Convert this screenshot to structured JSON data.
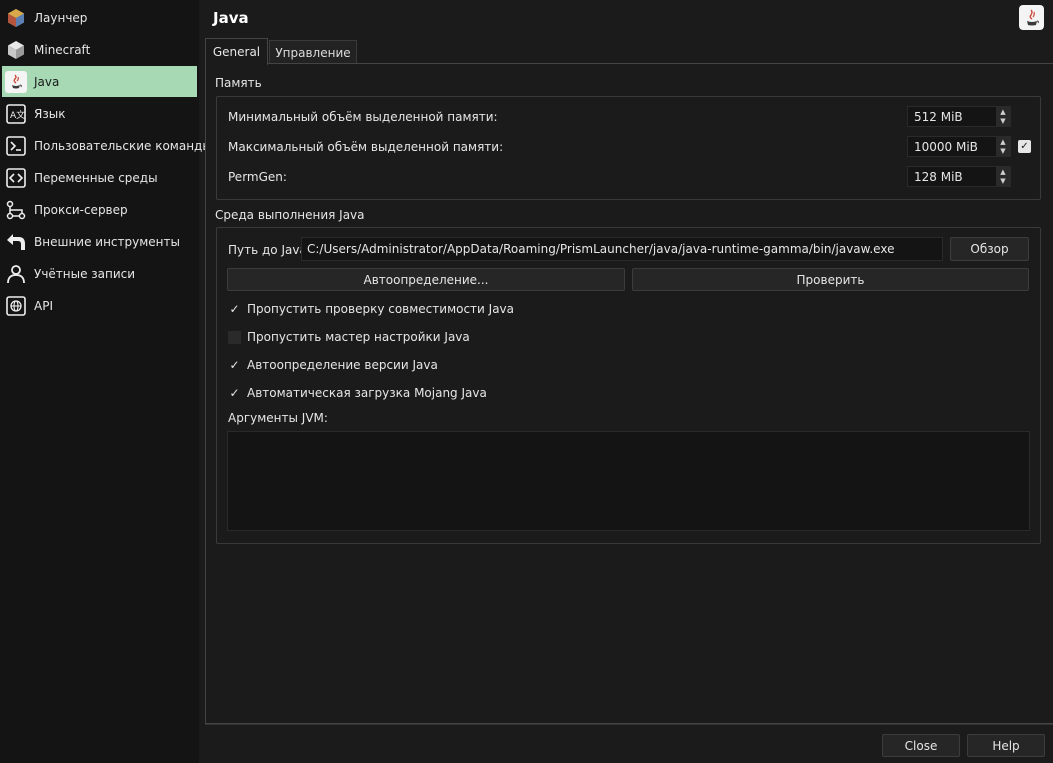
{
  "sidebar": {
    "items": [
      {
        "label": "Лаунчер",
        "icon": "launcher-icon",
        "active": false
      },
      {
        "label": "Minecraft",
        "icon": "minecraft-icon",
        "active": false
      },
      {
        "label": "Java",
        "icon": "java-icon",
        "active": true
      },
      {
        "label": "Язык",
        "icon": "language-icon",
        "active": false
      },
      {
        "label": "Пользовательские команды",
        "icon": "terminal-icon",
        "active": false
      },
      {
        "label": "Переменные среды",
        "icon": "code-icon",
        "active": false
      },
      {
        "label": "Прокси-сервер",
        "icon": "proxy-icon",
        "active": false
      },
      {
        "label": "Внешние инструменты",
        "icon": "external-tools-icon",
        "active": false
      },
      {
        "label": "Учётные записи",
        "icon": "accounts-icon",
        "active": false
      },
      {
        "label": "API",
        "icon": "api-icon",
        "active": false
      }
    ]
  },
  "header": {
    "title": "Java",
    "icon": "java-icon"
  },
  "tabs": [
    {
      "label": "General",
      "active": true
    },
    {
      "label": "Управление",
      "active": false
    }
  ],
  "memory": {
    "section_title": "Память",
    "min_label": "Минимальный объём выделенной памяти:",
    "min_value": "512 MiB",
    "max_label": "Максимальный объём выделенной памяти:",
    "max_value": "10000 MiB",
    "max_checked": true,
    "permgen_label": "PermGen:",
    "permgen_value": "128 MiB"
  },
  "runtime": {
    "section_title": "Среда выполнения Java",
    "path_label": "Путь до Java:",
    "path_value": "C:/Users/Administrator/AppData/Roaming/PrismLauncher/java/java-runtime-gamma/bin/javaw.exe",
    "browse_label": "Обзор",
    "autodetect_label": "Автоопределение...",
    "test_label": "Проверить",
    "checks": [
      {
        "label": "Пропустить проверку совместимости Java",
        "checked": true
      },
      {
        "label": "Пропустить мастер настройки Java",
        "checked": false
      },
      {
        "label": "Автоопределение версии Java",
        "checked": true
      },
      {
        "label": "Автоматическая загрузка Mojang Java",
        "checked": true
      }
    ],
    "jvm_args_label": "Аргументы JVM:",
    "jvm_args_value": ""
  },
  "footer": {
    "close_label": "Close",
    "help_label": "Help"
  },
  "colors": {
    "active_item": "#a6d9b4",
    "background": "#1b1b1b",
    "sidebar": "#141414"
  }
}
